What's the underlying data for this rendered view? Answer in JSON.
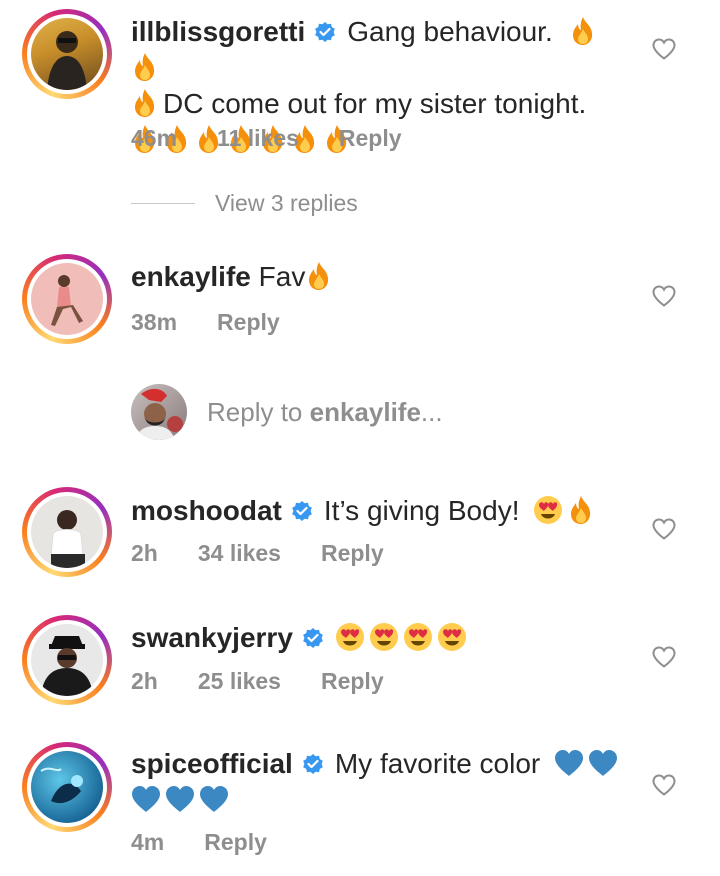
{
  "comments": [
    {
      "username": "illblissgoretti",
      "verified": true,
      "text_line1": "Gang behaviour.",
      "text_line2": "DC come out for my sister tonight.",
      "time": "46m",
      "likes": "11 likes",
      "reply": "Reply",
      "view_replies": "View 3 replies"
    },
    {
      "username": "enkaylife",
      "verified": false,
      "text": "Fav",
      "time": "38m",
      "reply": "Reply"
    },
    {
      "username": "moshoodat",
      "verified": true,
      "text": "It’s giving Body!",
      "time": "2h",
      "likes": "34 likes",
      "reply": "Reply"
    },
    {
      "username": "swankyjerry",
      "verified": true,
      "time": "2h",
      "likes": "25 likes",
      "reply": "Reply"
    },
    {
      "username": "spiceofficial",
      "verified": true,
      "text": "My favorite color",
      "time": "4m",
      "reply": "Reply"
    }
  ],
  "reply_composer": {
    "prefix": "Reply to",
    "target": "enkaylife",
    "ellipsis": "..."
  },
  "colors": {
    "verified_blue": "#3897f0",
    "meta_gray": "#8e8e8e",
    "text": "#262626"
  },
  "icons": {
    "fire": "fire-emoji",
    "heart_eyes": "heart-eyes-emoji",
    "blue_heart": "blue-heart-emoji",
    "like": "heart-outline-icon",
    "verified": "verified-badge-icon"
  }
}
